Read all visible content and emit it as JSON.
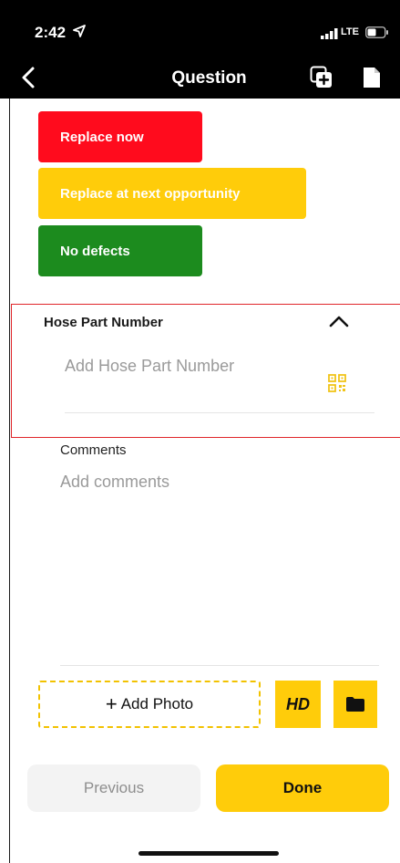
{
  "status_bar": {
    "time": "2:42",
    "network": "LTE",
    "icons": [
      "location-arrow-icon",
      "signal-bars-icon",
      "battery-icon"
    ]
  },
  "nav": {
    "title": "Question",
    "icons": [
      "back-chevron-icon",
      "copy-add-icon",
      "document-icon"
    ]
  },
  "options": [
    {
      "label": "Replace now",
      "color": "#ff0b1d"
    },
    {
      "label": "Replace at next opportunity",
      "color": "#ffcc0a"
    },
    {
      "label": "No defects",
      "color": "#1c8b1e"
    }
  ],
  "hose_section": {
    "label": "Hose Part Number",
    "placeholder": "Add Hose Part Number",
    "value": "",
    "highlight_color": "#e0262a",
    "icons": [
      "chevron-up-icon",
      "qr-code-icon"
    ]
  },
  "comments": {
    "label": "Comments",
    "placeholder": "Add comments",
    "value": ""
  },
  "photo": {
    "add_label": "Add Photo",
    "hd_label": "HD",
    "icons": [
      "plus-icon",
      "folder-icon"
    ]
  },
  "footer": {
    "previous_label": "Previous",
    "done_label": "Done"
  },
  "colors": {
    "accent": "#ffcc0a",
    "header_bg": "#000000"
  }
}
